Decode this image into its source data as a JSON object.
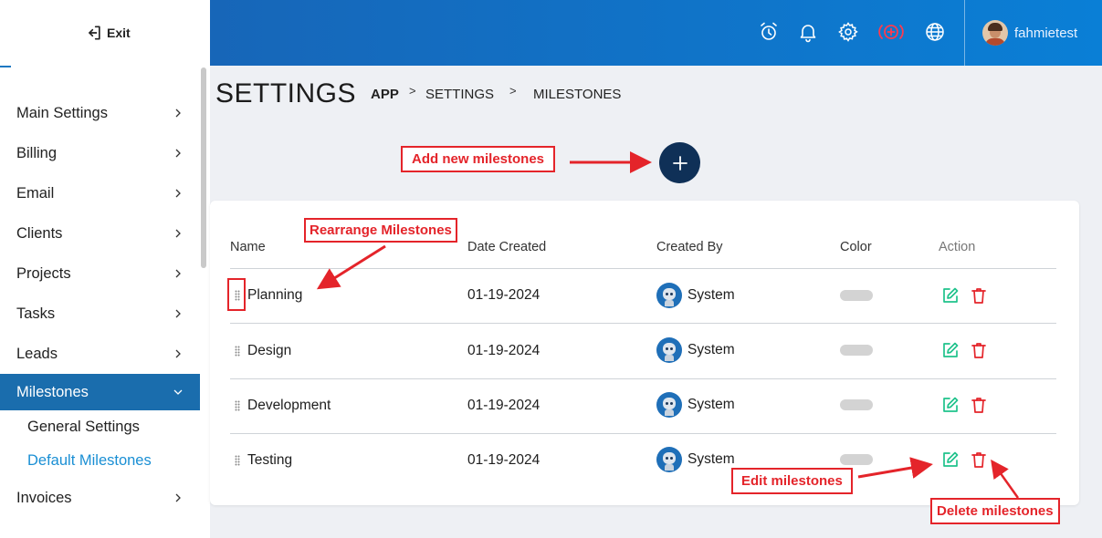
{
  "sidebar": {
    "exit_label": "Exit",
    "menu": [
      {
        "label": "Main Settings"
      },
      {
        "label": "Billing"
      },
      {
        "label": "Email"
      },
      {
        "label": "Clients"
      },
      {
        "label": "Projects"
      },
      {
        "label": "Tasks"
      },
      {
        "label": "Leads"
      },
      {
        "label": "Milestones",
        "active": true
      }
    ],
    "submenu": [
      {
        "label": "General Settings"
      },
      {
        "label": "Default Milestones",
        "selected": true
      }
    ],
    "after_menu": [
      {
        "label": "Invoices"
      }
    ]
  },
  "header": {
    "icons": [
      "alarm-clock-icon",
      "bell-icon",
      "gear-icon",
      "add-circle-icon",
      "globe-icon"
    ],
    "username": "fahmietest"
  },
  "breadcrumb": {
    "title": "SETTINGS",
    "items": [
      "APP",
      "SETTINGS",
      "MILESTONES"
    ]
  },
  "table": {
    "headers": [
      "Name",
      "Date Created",
      "Created By",
      "Color",
      "Action"
    ],
    "rows": [
      {
        "name": "Planning",
        "date": "01-19-2024",
        "created_by": "System"
      },
      {
        "name": "Design",
        "date": "01-19-2024",
        "created_by": "System"
      },
      {
        "name": "Development",
        "date": "01-19-2024",
        "created_by": "System"
      },
      {
        "name": "Testing",
        "date": "01-19-2024",
        "created_by": "System"
      }
    ]
  },
  "annotations": {
    "add": "Add new milestones",
    "rearrange": "Rearrange Milestones",
    "edit": "Edit milestones",
    "delete": "Delete milestones"
  },
  "colors": {
    "header_gradient_start": "#1766b8",
    "header_gradient_end": "#0a7fd6",
    "sidebar_active": "#1a6dad",
    "add_button": "#0f3057",
    "edit_icon": "#1ec28b",
    "delete_icon": "#e4242a",
    "annotation": "#e4242a",
    "milestone_color": "#d3d3d3"
  }
}
